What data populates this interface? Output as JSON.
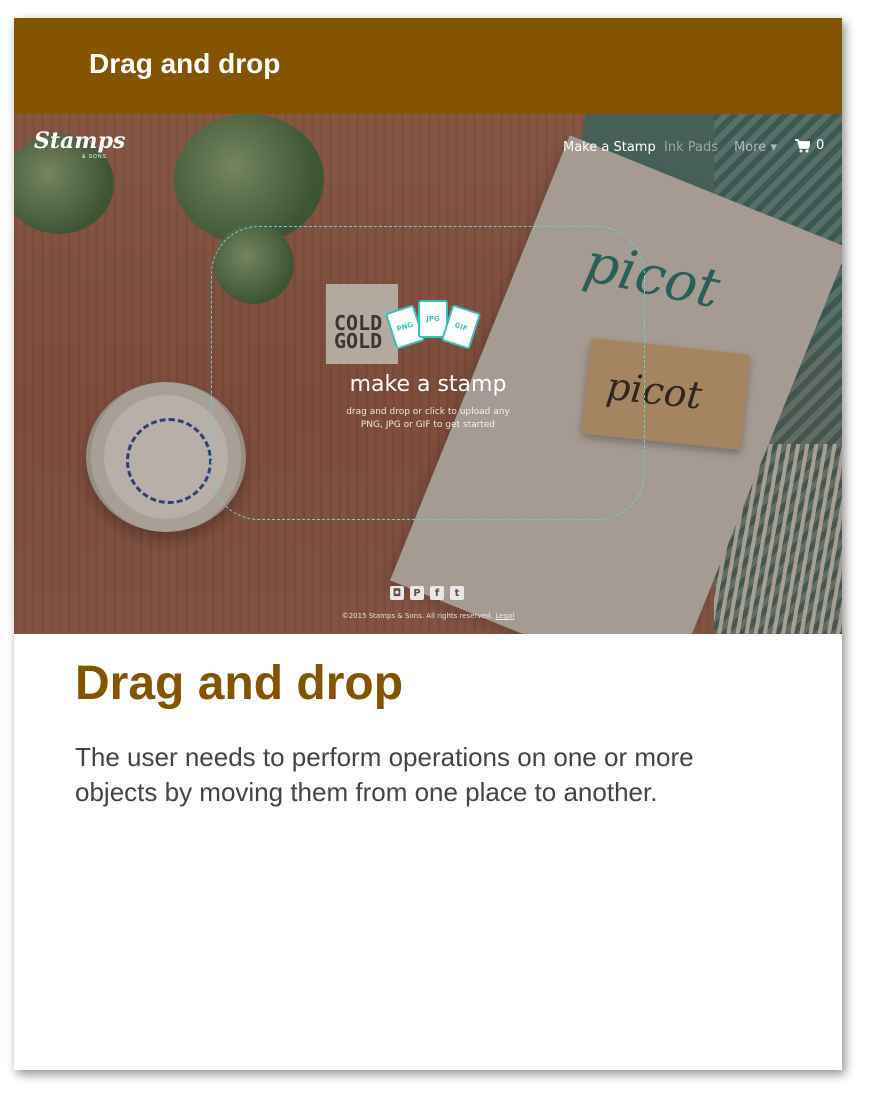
{
  "header": {
    "title": "Drag and drop"
  },
  "screenshot": {
    "logo": "Stamps",
    "logo_sub": "& SONS",
    "nav": {
      "make_stamp": "Make a Stamp",
      "ink_pads": "Ink Pads",
      "more": "More ▾",
      "cart_count": "0"
    },
    "dropzone": {
      "title": "make a stamp",
      "subtitle": "drag and drop or click to upload any PNG, JPG or GIF to get started",
      "file_types": [
        "PNG",
        "JPG",
        "GIF"
      ]
    },
    "background_texts": {
      "block_text": "picot",
      "script_text": "picot",
      "tag_text": "COLD GOLD"
    },
    "social_icons": [
      "instagram-icon",
      "pinterest-icon",
      "facebook-icon",
      "twitter-icon"
    ],
    "footer": {
      "copyright": "©2015 Stamps & Sons. All rights reserved.",
      "legal": "Legal"
    },
    "accent_color": "#5fd4d0"
  },
  "content": {
    "title": "Drag and drop",
    "description": "The user needs to perform operations on one or more objects by moving them from one place to another."
  },
  "colors": {
    "brand": "#855400",
    "text": "#444444"
  }
}
